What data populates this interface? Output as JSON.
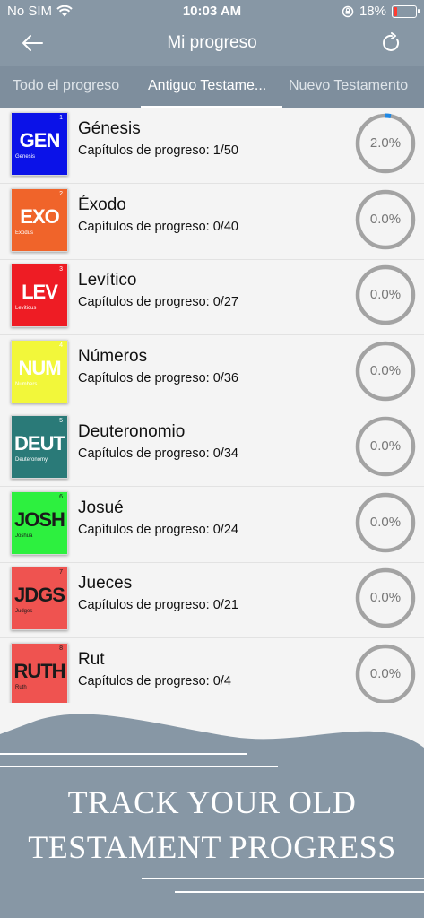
{
  "status_bar": {
    "carrier": "No SIM",
    "time": "10:03 AM",
    "battery": "18%",
    "battery_level": 0.18
  },
  "header": {
    "title": "Mi progreso",
    "back_icon": "arrow-left-icon",
    "refresh_icon": "refresh-icon"
  },
  "tabs": [
    {
      "label": "Todo el progreso",
      "active": false
    },
    {
      "label": "Antiguo Testame...",
      "active": true
    },
    {
      "label": "Nuevo Testamento",
      "active": false
    }
  ],
  "books": [
    {
      "abbr": "GEN",
      "num": "1",
      "sub": "Genesis",
      "name": "Génesis",
      "chapters": "Capítulos de progreso: 1/50",
      "percent": "2.0%",
      "progress": 0.02,
      "color": "#0b12e8",
      "text_color": "#ffffff"
    },
    {
      "abbr": "EXO",
      "num": "2",
      "sub": "Exodus",
      "name": "Éxodo",
      "chapters": "Capítulos de progreso: 0/40",
      "percent": "0.0%",
      "progress": 0,
      "color": "#f0642a",
      "text_color": "#ffffff"
    },
    {
      "abbr": "LEV",
      "num": "3",
      "sub": "Leviticus",
      "name": "Levítico",
      "chapters": "Capítulos de progreso: 0/27",
      "percent": "0.0%",
      "progress": 0,
      "color": "#ee1c24",
      "text_color": "#ffffff"
    },
    {
      "abbr": "NUM",
      "num": "4",
      "sub": "Numbers",
      "name": "Números",
      "chapters": "Capítulos de progreso: 0/36",
      "percent": "0.0%",
      "progress": 0,
      "color": "#f2f73a",
      "text_color": "#ffffff"
    },
    {
      "abbr": "DEUT",
      "num": "5",
      "sub": "Deuteronomy",
      "name": "Deuteronomio",
      "chapters": "Capítulos de progreso: 0/34",
      "percent": "0.0%",
      "progress": 0,
      "color": "#2a7a78",
      "text_color": "#ffffff"
    },
    {
      "abbr": "JOSH",
      "num": "6",
      "sub": "Joshua",
      "name": "Josué",
      "chapters": "Capítulos de progreso: 0/24",
      "percent": "0.0%",
      "progress": 0,
      "color": "#2df03f",
      "text_color": "#1a1a1a"
    },
    {
      "abbr": "JDGS",
      "num": "7",
      "sub": "Judges",
      "name": "Jueces",
      "chapters": "Capítulos de progreso: 0/21",
      "percent": "0.0%",
      "progress": 0,
      "color": "#ef5350",
      "text_color": "#1a1a1a"
    },
    {
      "abbr": "RUTH",
      "num": "8",
      "sub": "Ruth",
      "name": "Rut",
      "chapters": "Capítulos de progreso: 0/4",
      "percent": "0.0%",
      "progress": 0,
      "color": "#ef5350",
      "text_color": "#1a1a1a"
    }
  ],
  "promo": {
    "line1": "TRACK YOUR OLD",
    "line2": "TESTAMENT PROGRESS"
  },
  "colors": {
    "header_bg": "#8797a5",
    "ring_track": "#a3a3a3",
    "ring_progress": "#1e88e5"
  }
}
